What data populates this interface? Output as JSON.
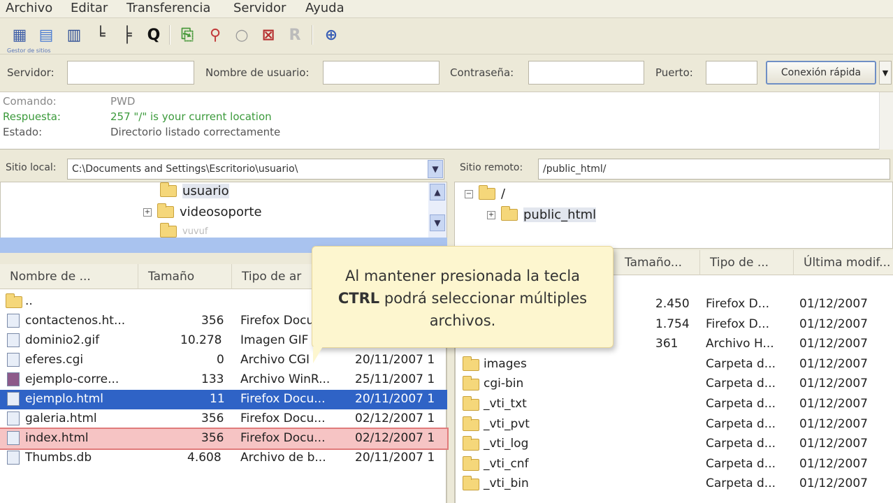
{
  "menu": [
    "Archivo",
    "Editar",
    "Transferencia",
    "Servidor",
    "Ayuda"
  ],
  "toolbar": {
    "tiny_label": "Gestor de sitios",
    "icons": [
      "site-manager-icon",
      "log-icon",
      "tree-icon",
      "remote-tree-icon",
      "queue-icon",
      "refresh-icon",
      "process-icon",
      "cancel-icon",
      "disconnect-icon",
      "reconnect-icon",
      "compare-icon"
    ]
  },
  "quickconnect": {
    "host_label": "Servidor:",
    "user_label": "Nombre de usuario:",
    "pass_label": "Contraseña:",
    "port_label": "Puerto:",
    "button": "Conexión rápida",
    "host_value": "",
    "user_value": "",
    "pass_value": "",
    "port_value": ""
  },
  "log": [
    {
      "key": "Comando:",
      "value": "PWD",
      "kind": "cmd"
    },
    {
      "key": "Respuesta:",
      "value": "257 \"/\" is your current location",
      "kind": "resp"
    },
    {
      "key": "Estado:",
      "value": "Directorio listado correctamente",
      "kind": "stat"
    }
  ],
  "local": {
    "site_label": "Sitio local:",
    "path": "C:\\Documents and Settings\\Escritorio\\usuario\\",
    "tree": [
      "usuario",
      "videosoporte",
      "vuvuf"
    ],
    "columns": [
      "Nombre de ...",
      "Tamaño",
      "Tipo de ar"
    ],
    "files": [
      {
        "name": "..",
        "size": "",
        "type": "",
        "date": ""
      },
      {
        "name": "contactenos.ht...",
        "size": "356",
        "type": "Firefox Docu",
        "date": ""
      },
      {
        "name": "dominio2.gif",
        "size": "10.278",
        "type": "Imagen GIF",
        "date": ""
      },
      {
        "name": "eferes.cgi",
        "size": "0",
        "type": "Archivo CGI",
        "date": "20/11/2007 1"
      },
      {
        "name": "ejemplo-corre...",
        "size": "133",
        "type": "Archivo WinR...",
        "date": "25/11/2007 1"
      },
      {
        "name": "ejemplo.html",
        "size": "11",
        "type": "Firefox Docu...",
        "date": "20/11/2007 1"
      },
      {
        "name": "galeria.html",
        "size": "356",
        "type": "Firefox Docu...",
        "date": "02/12/2007 1"
      },
      {
        "name": "index.html",
        "size": "356",
        "type": "Firefox Docu...",
        "date": "02/12/2007 1"
      },
      {
        "name": "Thumbs.db",
        "size": "4.608",
        "type": "Archivo de b...",
        "date": "20/11/2007 1"
      }
    ]
  },
  "remote": {
    "site_label": "Sitio remoto:",
    "path": "/public_html/",
    "tree": [
      "/",
      "public_html"
    ],
    "columns": [
      "Tamaño...",
      "Tipo de ...",
      "Última modif..."
    ],
    "files": [
      {
        "name": "",
        "size": "2.450",
        "type": "Firefox D...",
        "date": "01/12/2007"
      },
      {
        "name": "",
        "size": "1.754",
        "type": "Firefox D...",
        "date": "01/12/2007"
      },
      {
        "name": "",
        "size": "361",
        "type": "Archivo H...",
        "date": "01/12/2007"
      },
      {
        "name": "images",
        "size": "",
        "type": "Carpeta d...",
        "date": "01/12/2007"
      },
      {
        "name": "cgi-bin",
        "size": "",
        "type": "Carpeta d...",
        "date": "01/12/2007"
      },
      {
        "name": "_vti_txt",
        "size": "",
        "type": "Carpeta d...",
        "date": "01/12/2007"
      },
      {
        "name": "_vti_pvt",
        "size": "",
        "type": "Carpeta d...",
        "date": "01/12/2007"
      },
      {
        "name": "_vti_log",
        "size": "",
        "type": "Carpeta d...",
        "date": "01/12/2007"
      },
      {
        "name": "_vti_cnf",
        "size": "",
        "type": "Carpeta d...",
        "date": "01/12/2007"
      },
      {
        "name": "_vti_bin",
        "size": "",
        "type": "Carpeta d...",
        "date": "01/12/2007"
      }
    ]
  },
  "tooltip": {
    "pre": "Al mantener presionada la tecla",
    "key": "CTRL",
    "post": "podrá seleccionar múltiples archivos."
  }
}
